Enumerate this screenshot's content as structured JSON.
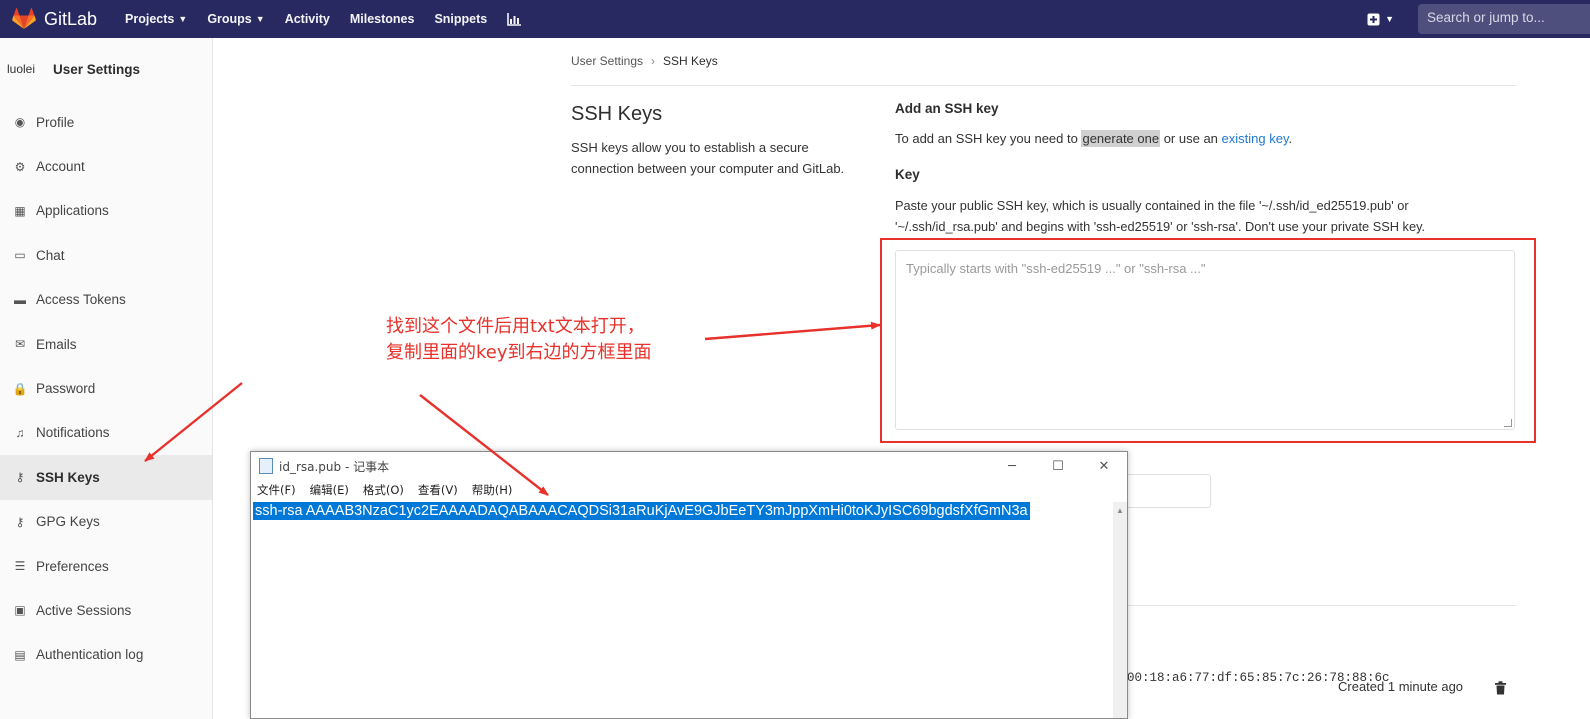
{
  "topbar": {
    "brand": "GitLab",
    "nav": [
      {
        "label": "Projects",
        "has_dropdown": true
      },
      {
        "label": "Groups",
        "has_dropdown": true
      },
      {
        "label": "Activity",
        "has_dropdown": false
      },
      {
        "label": "Milestones",
        "has_dropdown": false
      },
      {
        "label": "Snippets",
        "has_dropdown": false
      }
    ],
    "search_placeholder": "Search or jump to...",
    "colors": {
      "nav_bg": "#292961",
      "logo": "#fc6d26"
    }
  },
  "sidebar": {
    "avatar_alt": "luolei",
    "title": "User Settings",
    "items": [
      {
        "label": "Profile",
        "icon": "profile-icon"
      },
      {
        "label": "Account",
        "icon": "account-icon"
      },
      {
        "label": "Applications",
        "icon": "applications-icon"
      },
      {
        "label": "Chat",
        "icon": "chat-icon"
      },
      {
        "label": "Access Tokens",
        "icon": "token-icon"
      },
      {
        "label": "Emails",
        "icon": "email-icon"
      },
      {
        "label": "Password",
        "icon": "lock-icon"
      },
      {
        "label": "Notifications",
        "icon": "bell-icon"
      },
      {
        "label": "SSH Keys",
        "icon": "key-icon",
        "active": true
      },
      {
        "label": "GPG Keys",
        "icon": "key-icon"
      },
      {
        "label": "Preferences",
        "icon": "preferences-icon"
      },
      {
        "label": "Active Sessions",
        "icon": "monitor-icon"
      },
      {
        "label": "Authentication log",
        "icon": "log-icon"
      }
    ]
  },
  "breadcrumb": {
    "parent": "User Settings",
    "current": "SSH Keys"
  },
  "main": {
    "title": "SSH Keys",
    "description": "SSH keys allow you to establish a secure connection between your computer and GitLab.",
    "add_title": "Add an SSH key",
    "add_text_before": "To add an SSH key you need to ",
    "add_text_link1": "generate one",
    "add_text_middle": " or use an ",
    "add_text_link2": "existing key",
    "add_text_after": ".",
    "key_label": "Key",
    "key_help": "Paste your public SSH key, which is usually contained in the file '~/.ssh/id_ed25519.pub' or '~/.ssh/id_rsa.pub' and begins with 'ssh-ed25519' or 'ssh-rsa'. Don't use your private SSH key.",
    "key_placeholder": "Typically starts with \"ssh-ed25519 ...\" or \"ssh-rsa ...\"",
    "existing_key_fingerprint_fragment": "00:18:a6:77:df:65:85:7c:26:78:88:6c",
    "existing_key_created": "Created 1 minute ago"
  },
  "annotation": {
    "line1": "找到这个文件后用txt文本打开，",
    "line2": "复制里面的key到右边的方框里面",
    "color": "#e8312a"
  },
  "notepad": {
    "title": "id_rsa.pub - 记事本",
    "menu": [
      "文件(F)",
      "编辑(E)",
      "格式(O)",
      "查看(V)",
      "帮助(H)"
    ],
    "content": "ssh-rsa AAAAB3NzaC1yc2EAAAADAQABAAACAQDSi31aRuKjAvE9GJbEeTY3mJppXmHi0toKJyISC69bgdsfXfGmN3a",
    "selection_color": "#0078d7"
  }
}
